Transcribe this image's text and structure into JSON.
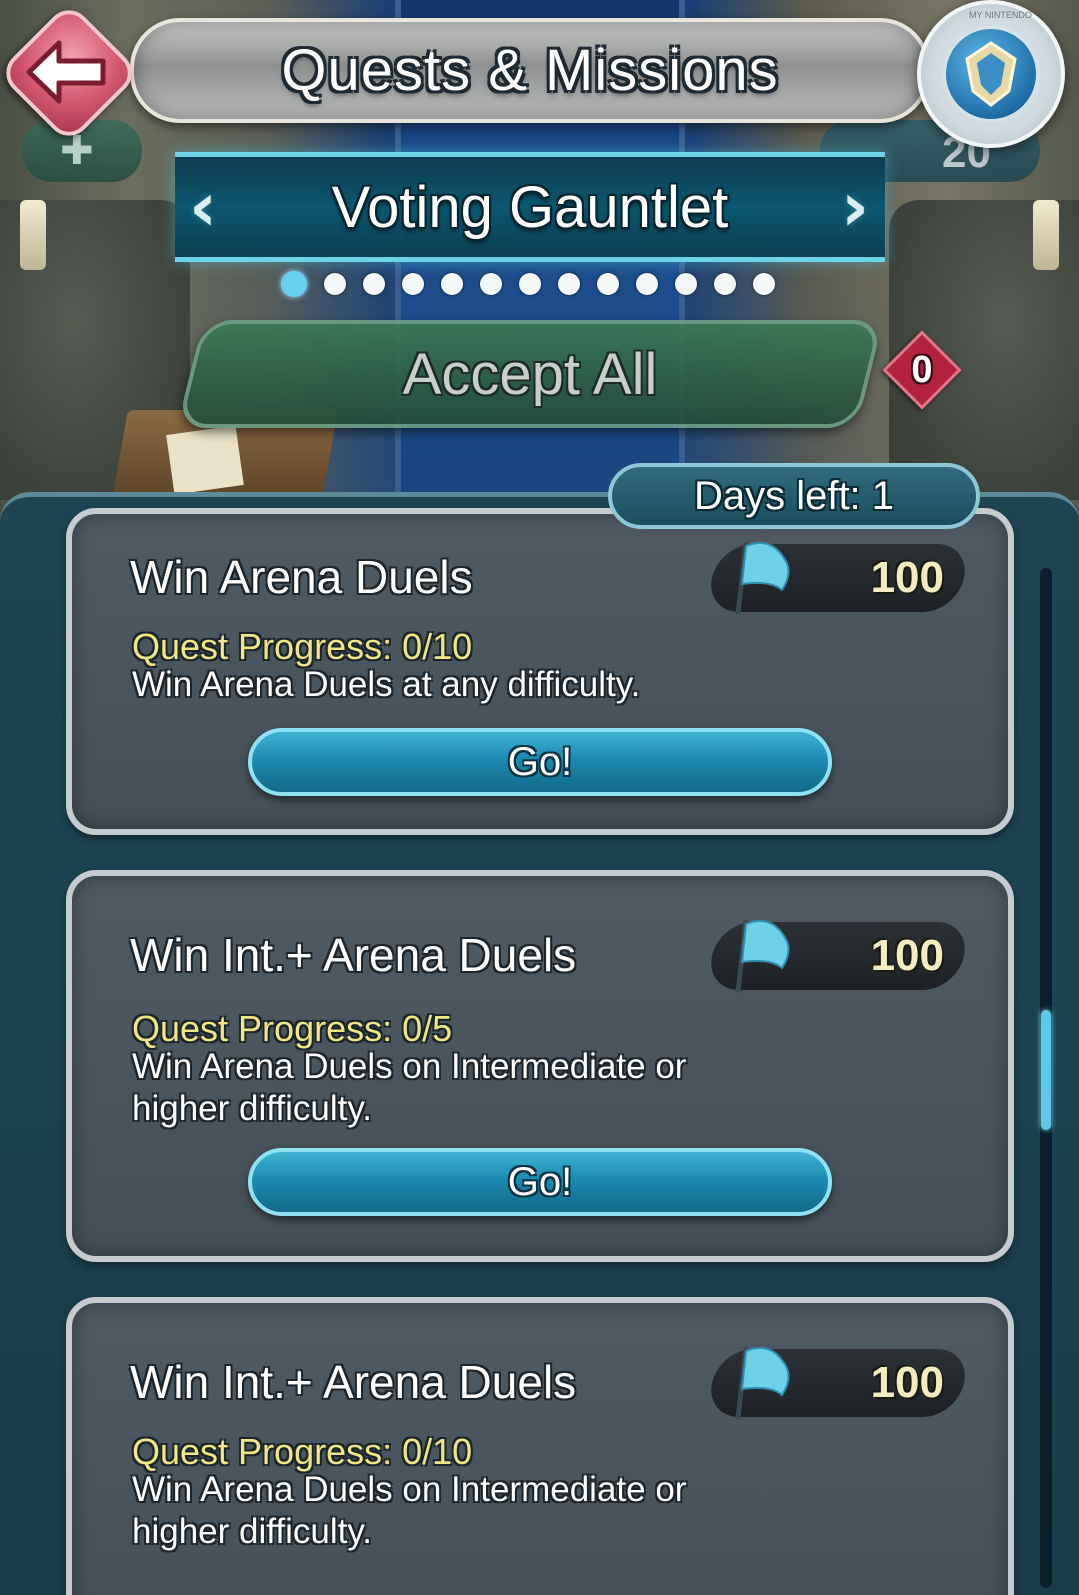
{
  "header": {
    "title": "Quests & Missions",
    "back_icon": "back-arrow-icon",
    "badge_ring_text": "MY NINTENDO",
    "right_indicator_value": "20"
  },
  "gauntlet": {
    "title": "Voting Gauntlet",
    "page_count": 13,
    "active_page": 1
  },
  "accept_all": {
    "label": "Accept All",
    "count": "0"
  },
  "days_left": "Days left: 1",
  "quests": [
    {
      "title": "Win Arena Duels",
      "reward": "100",
      "progress": "Quest Progress: 0/10",
      "description": "Win Arena Duels at any difficulty.",
      "button": "Go!"
    },
    {
      "title": "Win Int.+ Arena Duels",
      "reward": "100",
      "progress": "Quest Progress: 0/5",
      "description": "Win Arena Duels on Intermediate or higher difficulty.",
      "button": "Go!"
    },
    {
      "title": "Win Int.+ Arena Duels",
      "reward": "100",
      "progress": "Quest Progress: 0/10",
      "description": "Win Arena Duels on Intermediate or higher difficulty.",
      "button": ""
    }
  ],
  "colors": {
    "accent": "#5cc9e9",
    "progress_text": "#efe686",
    "reward_text": "#f2ecc0",
    "back_button": "#d4596f"
  }
}
